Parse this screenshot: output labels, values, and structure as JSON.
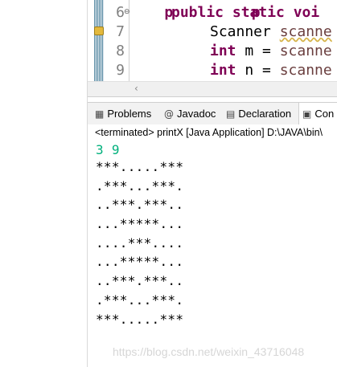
{
  "editor": {
    "top_partial": "p         p     ",
    "lines": [
      {
        "num": "6",
        "code_parts": [
          "public static voi"
        ]
      },
      {
        "num": "7",
        "code_parts": [
          "Scanner ",
          "scanne"
        ]
      },
      {
        "num": "8",
        "code_parts": [
          "int",
          " m = ",
          "scanne"
        ]
      },
      {
        "num": "9",
        "code_parts": [
          "int",
          " n = ",
          "scanne"
        ]
      }
    ],
    "fold_glyph": "⊖",
    "scroll_left_glyph": "‹"
  },
  "tabs": [
    {
      "icon": "problems-icon",
      "glyph": "▦",
      "label": "Problems"
    },
    {
      "icon": "javadoc-icon",
      "glyph": "@",
      "label": "Javadoc"
    },
    {
      "icon": "declaration-icon",
      "glyph": "▤",
      "label": "Declaration"
    },
    {
      "icon": "console-icon",
      "glyph": "▣",
      "label": "Con"
    }
  ],
  "console": {
    "terminated": "<terminated> printX [Java Application] D:\\JAVA\\bin\\",
    "input": "3 9",
    "output": [
      "***.....***",
      ".***...***.",
      "..***.***..",
      "...*****...",
      "....***....",
      "...*****...",
      "..***.***..",
      ".***...***.",
      "***.....***"
    ],
    "watermark": "https://blog.csdn.net/weixin_43716048"
  },
  "colors": {
    "keyword": "#7f0055",
    "variable": "#6a3e3e",
    "console_input": "#00b07c"
  }
}
